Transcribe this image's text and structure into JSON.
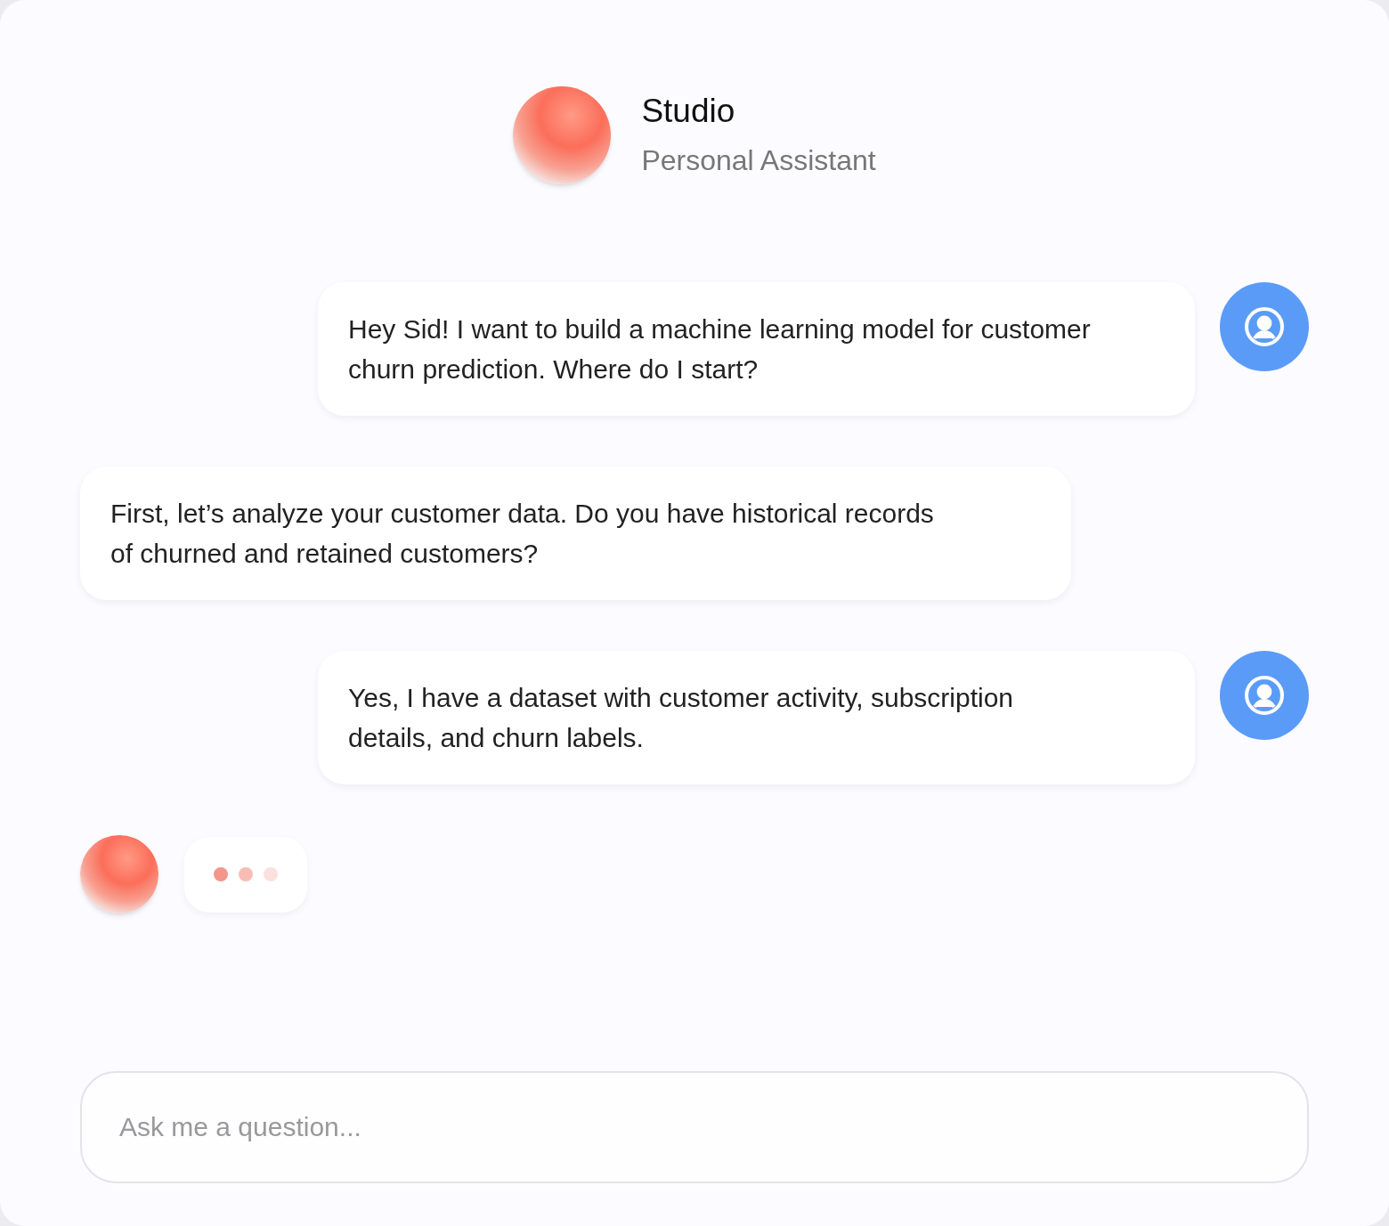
{
  "header": {
    "title": "Studio",
    "subtitle": "Personal Assistant"
  },
  "messages": [
    {
      "kind": "user",
      "text": "Hey Sid! I want to build a machine learning model for customer churn prediction. Where do I start?"
    },
    {
      "kind": "assistant",
      "text": "First, let’s analyze your customer data. Do you have historical records of churned and retained customers?"
    },
    {
      "kind": "user",
      "text": "Yes, I have a dataset with customer activity, subscription details, and churn labels."
    }
  ],
  "typing": true,
  "input": {
    "placeholder": "Ask me a question..."
  }
}
